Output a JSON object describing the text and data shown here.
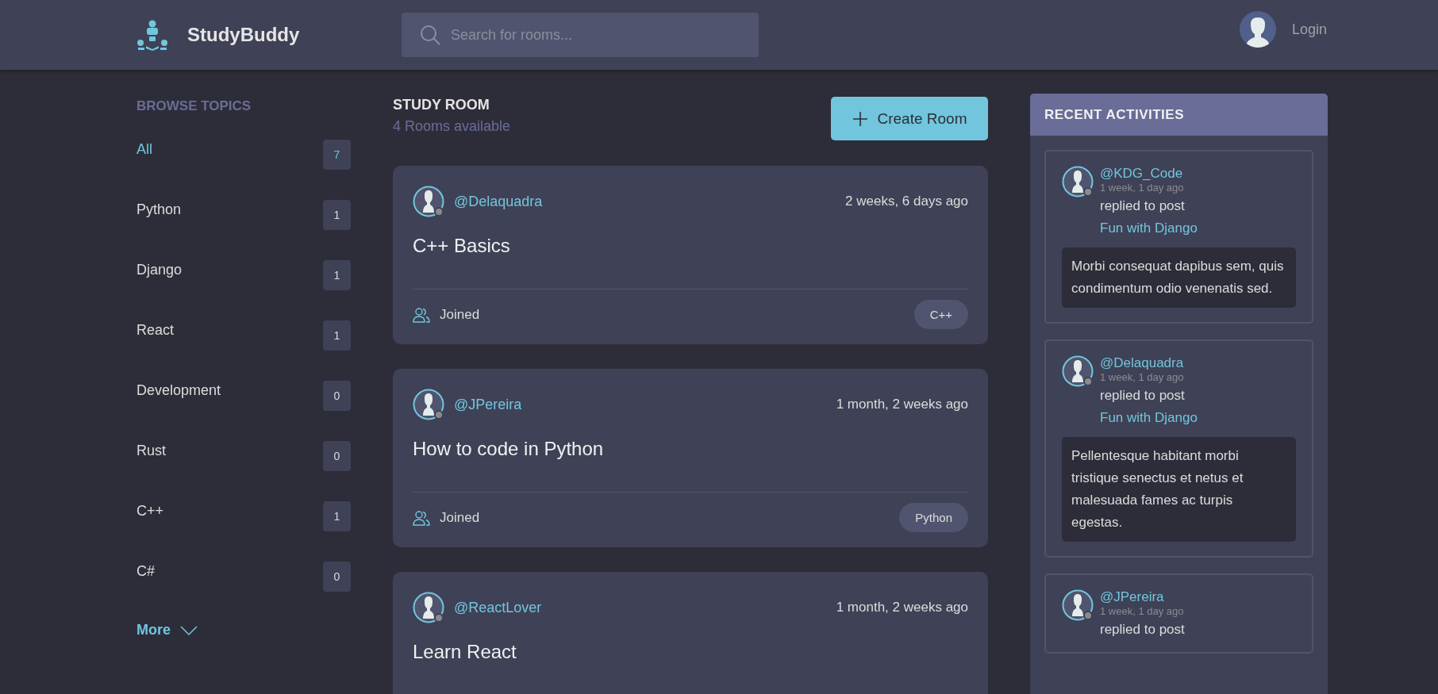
{
  "header": {
    "logo": "StudyBuddy",
    "search": {
      "placeholder": "Search for rooms..."
    },
    "login": "Login"
  },
  "sidebar": {
    "title": "BROWSE TOPICS",
    "topics": [
      {
        "name": "All",
        "count": "7",
        "selected": true
      },
      {
        "name": "Python",
        "count": "1",
        "selected": false
      },
      {
        "name": "Django",
        "count": "1",
        "selected": false
      },
      {
        "name": "React",
        "count": "1",
        "selected": false
      },
      {
        "name": "Development",
        "count": "0",
        "selected": false
      },
      {
        "name": "Rust",
        "count": "0",
        "selected": false
      },
      {
        "name": "C++",
        "count": "1",
        "selected": false
      },
      {
        "name": "C#",
        "count": "0",
        "selected": false
      }
    ],
    "more": "More"
  },
  "main": {
    "title": "STUDY ROOM",
    "subtitle": "4 Rooms available",
    "create_button": "Create Room",
    "rooms": [
      {
        "user": "@Delaquadra",
        "time": "2 weeks, 6 days ago",
        "title": "C++ Basics",
        "status": "Joined",
        "topic": "C++"
      },
      {
        "user": "@JPereira",
        "time": "1 month, 2 weeks ago",
        "title": "How to code in Python",
        "status": "Joined",
        "topic": "Python"
      },
      {
        "user": "@ReactLover",
        "time": "1 month, 2 weeks ago",
        "title": "Learn React"
      }
    ]
  },
  "activities": {
    "title": "RECENT ACTIVITIES",
    "items": [
      {
        "user": "@KDG_Code",
        "time": "1 week, 1 day ago",
        "action": "replied to post",
        "room": "Fun with Django",
        "message": "Morbi consequat dapibus sem, quis condimentum odio venenatis sed."
      },
      {
        "user": "@Delaquadra",
        "time": "1 week, 1 day ago",
        "action": "replied to post",
        "room": "Fun with Django",
        "message": "Pellentesque habitant morbi tristique senectus et netus et malesuada fames ac turpis egestas."
      },
      {
        "user": "@JPereira",
        "time": "1 week, 1 day ago",
        "action": "replied to post"
      }
    ]
  }
}
